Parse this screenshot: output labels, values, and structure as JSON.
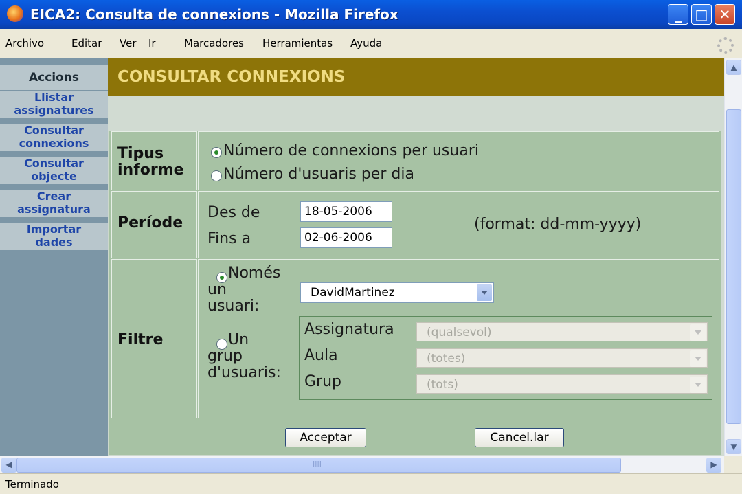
{
  "window": {
    "title": "EICA2: Consulta de connexions - Mozilla Firefox",
    "minimize_glyph": "_",
    "maximize_glyph": "□",
    "close_glyph": "✕"
  },
  "menu": {
    "items": [
      "Archivo",
      "Editar",
      "Ver",
      "Ir",
      "Marcadores",
      "Herramientas",
      "Ayuda"
    ]
  },
  "sidebar": {
    "heading": "Accions",
    "links": [
      {
        "line1": "Llistar",
        "line2": "assignatures"
      },
      {
        "line1": "Consultar",
        "line2": "connexions"
      },
      {
        "line1": "Consultar",
        "line2": "objecte"
      },
      {
        "line1": "Crear",
        "line2": "assignatura"
      },
      {
        "line1": "Importar",
        "line2": "dades"
      }
    ]
  },
  "main": {
    "title": "CONSULTAR CONNEXIONS",
    "tipus": {
      "label_line1": "Tipus",
      "label_line2": "informe",
      "option1": "Número de connexions per usuari",
      "option2": "Número d'usuaris per dia",
      "selected": 1
    },
    "periode": {
      "label": "Període",
      "des_label": "Des de",
      "des_value": "18-05-2006",
      "fins_label": "Fins a",
      "fins_value": "02-06-2006",
      "format_hint": "(format: dd-mm-yyyy)"
    },
    "filtre": {
      "label": "Filtre",
      "opt1_line1": "Només",
      "opt1_line2": "un",
      "opt1_line3": "usuari:",
      "user_value": "DavidMartinez",
      "opt2_line1": "Un",
      "opt2_line2": "grup",
      "opt2_line3": "d'usuaris:",
      "assignatura_label": "Assignatura",
      "assignatura_value": "(qualsevol)",
      "aula_label": "Aula",
      "aula_value": "(totes)",
      "grup_label": "Grup",
      "grup_value": "(tots)",
      "selected": 1
    },
    "buttons": {
      "accept": "Acceptar",
      "cancel": "Cancel.lar"
    }
  },
  "scrollbar": {
    "hscroll_grip": "IIII",
    "up_glyph": "▲",
    "down_glyph": "▼",
    "left_glyph": "◀",
    "right_glyph": "▶"
  },
  "status": {
    "text": "Terminado"
  }
}
